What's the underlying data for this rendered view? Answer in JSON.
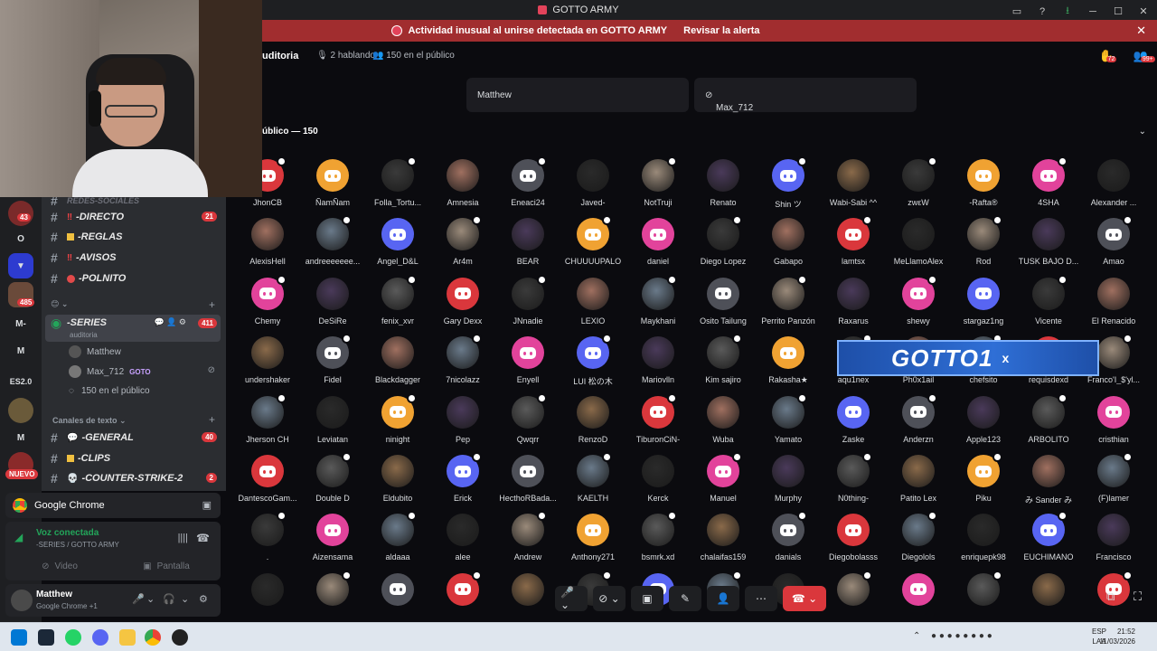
{
  "window": {
    "title": "GOTTO ARMY"
  },
  "alert": {
    "text": "Actividad inusual al unirse detectada en GOTTO ARMY",
    "action": "Revisar la alerta"
  },
  "rail": {
    "items": [
      {
        "label": "",
        "badge": "43"
      },
      {
        "label": "O",
        "badge": ""
      },
      {
        "label": "",
        "badge": ""
      },
      {
        "label": "",
        "badge": "485"
      },
      {
        "label": "M-",
        "badge": ""
      },
      {
        "label": "M",
        "badge": ""
      },
      {
        "label": "ES2.0",
        "badge": ""
      },
      {
        "label": "",
        "badge": ""
      },
      {
        "label": "M",
        "badge": ""
      }
    ],
    "new_label": "NUEVO"
  },
  "channels": {
    "cut_top": "REDES-SOCIALES",
    "text_top": [
      {
        "emoji": "‼",
        "name": "-DIRECTO",
        "badge": "21"
      },
      {
        "emoji": "",
        "name": "-REGLAS",
        "badge": ""
      },
      {
        "emoji": "‼",
        "name": "-AVISOS",
        "badge": ""
      },
      {
        "emoji": "",
        "name": "-POLNITO",
        "badge": ""
      }
    ],
    "voice": {
      "name": "-SERIES",
      "sub": "auditoria",
      "badge": "411",
      "users": [
        "Matthew",
        "Max_712"
      ],
      "user2_tag": "GOTO",
      "audience": "150 en el público"
    },
    "category": "Canales de texto",
    "text_bottom": [
      {
        "emoji": "💬",
        "name": "-GENERAL",
        "badge": "40"
      },
      {
        "emoji": "",
        "name": "-CLIPS",
        "badge": ""
      },
      {
        "emoji": "💀",
        "name": "-COUNTER-STRIKE-2",
        "badge": "2"
      }
    ]
  },
  "chrome_bar": {
    "label": "Google Chrome"
  },
  "voice_panel": {
    "title": "Voz conectada",
    "sub": "-SERIES / GOTTO ARMY",
    "video": "Video",
    "screen": "Pantalla"
  },
  "user_panel": {
    "name": "Matthew",
    "sub": "Google Chrome +1"
  },
  "stage": {
    "title": "uditoria",
    "talking": "2 hablando",
    "audience": "150 en el público",
    "hdr_badge1": "72",
    "hdr_badge2": "99+",
    "speakers": [
      "Matthew",
      "Max_712"
    ],
    "publico_label": "úblico — 150"
  },
  "audience_rows": [
    [
      "JhonCB",
      "ÑamÑam",
      "Folla_Tortu...",
      "Amnesia",
      "Eneaci24",
      "Javed-",
      "NotTruji",
      "Renato",
      "Shin ツ",
      "Wabi-Sabi ^^",
      "zwεW",
      "-Rafta®",
      "4SHA",
      "Alexander ..."
    ],
    [
      "AlexisHell",
      "andreeeeeee...",
      "Angel_D&L",
      "Ar4m",
      "BEAR",
      "CHUUUUPALO",
      "daniel",
      "Diego Lopez",
      "Gabapo",
      "lamtsx",
      "MeLlamoAlex",
      "Rod",
      "TUSK BAJO D...",
      "Amao"
    ],
    [
      "Chemy",
      "DeSiRe",
      "fenix_xvr",
      "Gary Dexx",
      "JNnadie",
      "LEXIO",
      "Maykhani",
      "Osito Tailung",
      "Perrito Panzón",
      "Raxarus",
      "shewy",
      "stargaz1ng",
      "Vicente",
      "El Renacido"
    ],
    [
      "undershaker",
      "Fidel",
      "Blackdagger",
      "7nicolazz",
      "Enyell",
      "LUI 松の木",
      "Mariovlln",
      "Kim sajiro",
      "Rakasha★",
      "aqu1nex",
      "Ph0x1ail",
      "chefsito",
      "requisdexd",
      "Franco'I_$'yl..."
    ],
    [
      "Jherson CH",
      "Leviatan",
      "ninight",
      "Pep",
      "Qwqrr",
      "RenzoD",
      "TiburonCiN-",
      "Wuba",
      "Yamato",
      "Zaske",
      "Anderzn",
      "Apple123",
      "ARBOLITO",
      "cristhian"
    ],
    [
      "DantescoGam...",
      "Double D",
      "Eldubito",
      "Erick",
      "HecthoRBada...",
      "KAELTH",
      "Kerck",
      "Manuel",
      "Murphy",
      "N0thing-",
      "Patito Lex",
      "Piku",
      "み Sander み",
      "(F)lamer"
    ],
    [
      ".",
      "Aizensama",
      "aldaaa",
      "alee",
      "Andrew",
      "Anthony271",
      "bsmrk.xd",
      "chalaifas159",
      "danials",
      "Diegobolasss",
      "Diegolols",
      "enriquepk98",
      "EUCHIMANO",
      "Francisco"
    ],
    [
      "",
      "",
      "",
      "",
      "",
      "",
      "",
      "",
      "",
      "",
      "",
      "",
      "",
      ""
    ]
  ],
  "overlay": {
    "text": "GOTTO1",
    "x": "x"
  },
  "taskbar": {
    "lang": "ESP",
    "lang2": "LAA",
    "time": "21:52",
    "date": "11/03/2026"
  },
  "colors": {
    "discord_red": "#da373c",
    "discord_orange": "#f0a232",
    "discord_pink": "#e2439b",
    "discord_blurple": "#5865f2",
    "discord_gray": "#4e5058",
    "connected_green": "#23a55a"
  }
}
